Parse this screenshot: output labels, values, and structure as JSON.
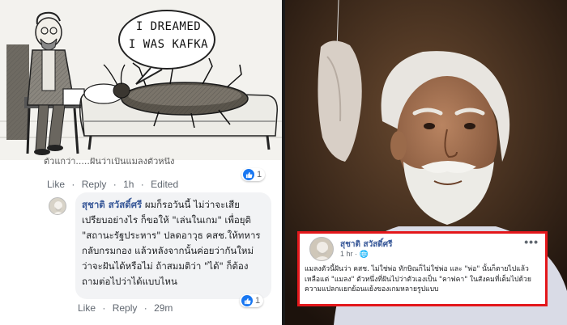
{
  "cartoon": {
    "speech_line1": "I DREAMED",
    "speech_line2": "I WAS KAFKA"
  },
  "clipped_comment": "ตัวแกว่า.....ฝันว่าเป็นแมลงตัวหนึ่ง",
  "comment1_actions": {
    "like": "Like",
    "reply": "Reply",
    "time": "1h",
    "edited": "Edited",
    "reactions": "1"
  },
  "comment2": {
    "author": "สุชาติ สวัสดิ์ศรี",
    "text": "ผมก็รอวันนี้ ไม่ว่าจะเสียเปรียบอย่างไร ก็ขอให้ \"เล่นในเกม\" เพื่อยุติ \"สถานะรัฐประหาร\" ปลดอาวุธ คสช.ให้ทหารกลับกรมกอง แล้วหลังจากนั้นค่อยว่ากันใหม่ว่าจะฝันได้หรือไม่ ถ้าสมมติว่า \"ได้\" ก็ต้องถามต่อไปว่าได้แบบไหน",
    "like": "Like",
    "reply": "Reply",
    "time": "29m",
    "reactions": "1"
  },
  "post": {
    "author": "สุชาติ สวัสดิ์ศรี",
    "meta": "1 hr · 🌐",
    "menu": "•••",
    "text": "แมลงตัวนี้ฝันว่า คสช. ไม่ใช่พ่อ ทักษิณก็ไม่ใช่พ่อ และ \"พ่อ\" นั้นก็ตายไปแล้ว เหลือแต่ \"แมลง\" ตัวหนึ่งที่ฝันไปว่าตัวเองเป็น \"คาฟคา\" ในสังคมที่เต็มไปด้วยความแปลกแยกย้อนแย้งของเกมหลายรูปแบบ"
  },
  "colors": {
    "facebook_link": "#385898",
    "facebook_blue": "#1877f2",
    "highlight_border": "#e3171b",
    "comment_bg": "#f2f3f5"
  }
}
